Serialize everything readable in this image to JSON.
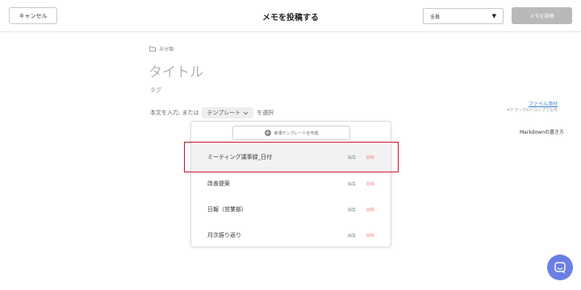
{
  "header": {
    "cancel_label": "キャンセル",
    "title": "メモを投稿する",
    "scope_value": "全員",
    "post_label": "メモを投稿"
  },
  "editor": {
    "folder_label": "未分類",
    "title_placeholder": "タイトル",
    "tags_placeholder": "タグ",
    "prompt_before": "本文を入力, または",
    "template_chip_label": "テンプレート",
    "prompt_after": "を選択"
  },
  "side": {
    "file_attach_label": "ファイル添付",
    "file_attach_hint": "※ドラッグ&ドロップでも可",
    "markdown_help_label": "Markdownの書き方"
  },
  "template_menu": {
    "new_template_label": "新規テンプレートを作成",
    "edit_label": "編集",
    "delete_label": "削除",
    "items": [
      {
        "name": "ミーティング議事録_日付"
      },
      {
        "name": "改善提案"
      },
      {
        "name": "日報（営業部）"
      },
      {
        "name": "月次振り返り"
      }
    ]
  },
  "colors": {
    "highlight_box": "#c8102e",
    "link": "#3a7bd5",
    "delete": "#f08a8a",
    "chat_button": "#6b7fe3",
    "post_button": "#b9b9b9"
  },
  "icons": {
    "folder": "folder-icon",
    "chevron": "chevron-down-icon",
    "select_caret": "caret-down-icon",
    "plus": "plus-icon",
    "chat": "chat-icon"
  }
}
